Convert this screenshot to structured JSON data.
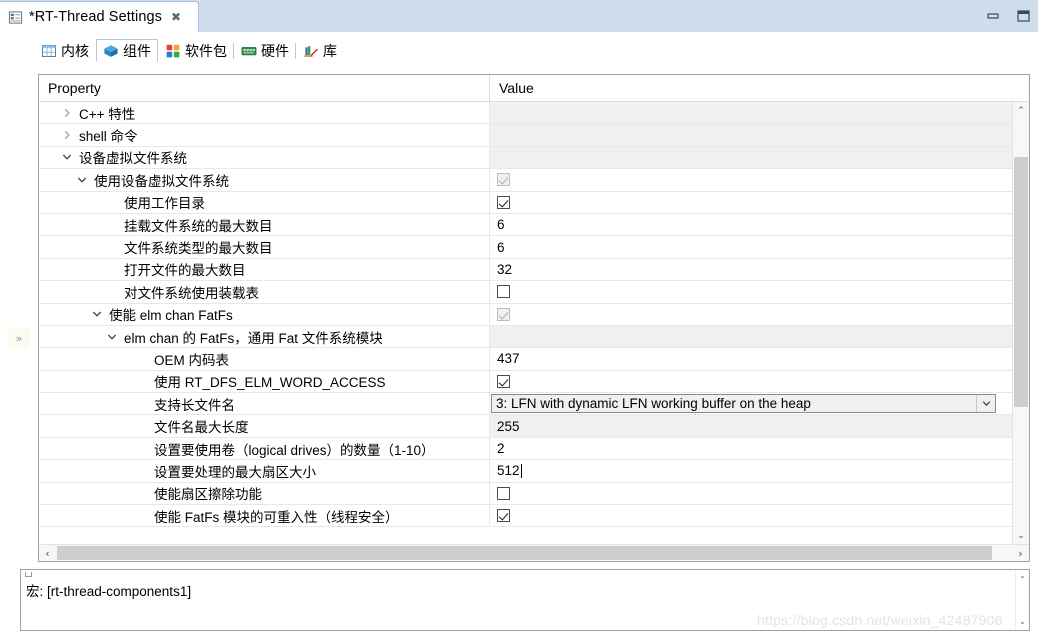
{
  "window": {
    "tab_title": "*RT-Thread Settings",
    "tab_icon": "settings-table-icon",
    "close_label": "╳",
    "minimize_label": "minimize-icon",
    "maximize_label": "maximize-icon"
  },
  "subtabs": [
    {
      "label": "内核",
      "icon": "kernel-grid-icon",
      "active": false
    },
    {
      "label": "组件",
      "icon": "components-cube-icon",
      "active": true
    },
    {
      "label": "软件包",
      "icon": "packages-icon",
      "active": false
    },
    {
      "label": "硬件",
      "icon": "hardware-board-icon",
      "active": false
    },
    {
      "label": "库",
      "icon": "library-books-icon",
      "active": false
    }
  ],
  "left_strip": {
    "restore_label": "»"
  },
  "table": {
    "columns": {
      "property": "Property",
      "value": "Value"
    },
    "rows": [
      {
        "label": "C++ 特性",
        "indent": 1,
        "twisty": "collapsed",
        "value_type": "shaded",
        "value": ""
      },
      {
        "label": "shell 命令",
        "indent": 1,
        "twisty": "collapsed",
        "value_type": "shaded",
        "value": ""
      },
      {
        "label": "设备虚拟文件系统",
        "indent": 1,
        "twisty": "expanded",
        "value_type": "shaded",
        "value": ""
      },
      {
        "label": "使用设备虚拟文件系统",
        "indent": 2,
        "twisty": "expanded",
        "value_type": "checkbox-disabled-checked",
        "value": ""
      },
      {
        "label": "使用工作目录",
        "indent": 4,
        "twisty": "none",
        "value_type": "checkbox-checked",
        "value": ""
      },
      {
        "label": "挂载文件系统的最大数目",
        "indent": 4,
        "twisty": "none",
        "value_type": "text",
        "value": "6"
      },
      {
        "label": "文件系统类型的最大数目",
        "indent": 4,
        "twisty": "none",
        "value_type": "text",
        "value": "6"
      },
      {
        "label": "打开文件的最大数目",
        "indent": 4,
        "twisty": "none",
        "value_type": "text",
        "value": "32"
      },
      {
        "label": "对文件系统使用装载表",
        "indent": 4,
        "twisty": "none",
        "value_type": "checkbox-unchecked",
        "value": ""
      },
      {
        "label": "使能 elm chan FatFs",
        "indent": 3,
        "twisty": "expanded",
        "value_type": "checkbox-disabled-checked",
        "value": ""
      },
      {
        "label": "elm chan 的 FatFs，通用 Fat 文件系统模块",
        "indent": 4,
        "twisty": "expanded",
        "value_type": "shaded",
        "value": ""
      },
      {
        "label": "OEM 内码表",
        "indent": 6,
        "twisty": "none",
        "value_type": "text",
        "value": "437"
      },
      {
        "label": "使用 RT_DFS_ELM_WORD_ACCESS",
        "indent": 6,
        "twisty": "none",
        "value_type": "checkbox-checked",
        "value": ""
      },
      {
        "label": "支持长文件名",
        "indent": 6,
        "twisty": "none",
        "value_type": "combo",
        "value": "3: LFN with dynamic LFN working buffer on the heap"
      },
      {
        "label": "文件名最大长度",
        "indent": 6,
        "twisty": "none",
        "value_type": "shaded-text",
        "value": "255"
      },
      {
        "label": "设置要使用卷（logical drives）的数量（1-10）",
        "indent": 6,
        "twisty": "none",
        "value_type": "text",
        "value": "2"
      },
      {
        "label": "设置要处理的最大扇区大小",
        "indent": 6,
        "twisty": "none",
        "value_type": "editing",
        "value": "512"
      },
      {
        "label": "使能扇区擦除功能",
        "indent": 6,
        "twisty": "none",
        "value_type": "checkbox-unchecked",
        "value": ""
      },
      {
        "label": "使能 FatFs 模块的可重入性（线程安全）",
        "indent": 6,
        "twisty": "none",
        "value_type": "checkbox-checked",
        "value": ""
      }
    ]
  },
  "scrollbars": {
    "v_up": "⌃",
    "v_down": "⌄",
    "h_left": "‹",
    "h_right": "›"
  },
  "status": {
    "text": "宏: [rt-thread-components1]"
  },
  "watermark": {
    "text": "https://blog.csdn.net/weixin_42487906"
  },
  "colors": {
    "titlebar": "#cfddec",
    "accent": "#4a90d9",
    "row_border": "#e8e8e8",
    "shade": "#f0f0f0"
  }
}
